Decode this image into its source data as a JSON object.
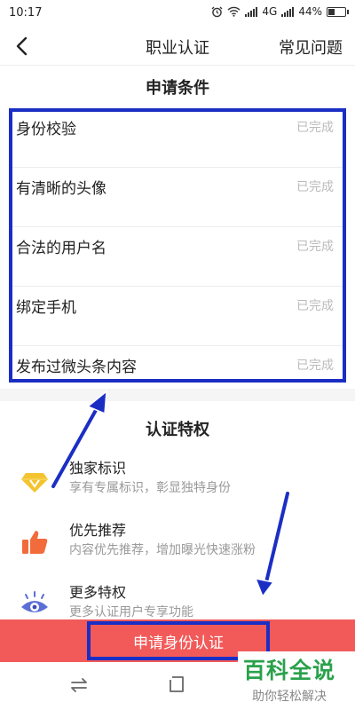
{
  "status_bar": {
    "time": "10:17",
    "network": "4G",
    "battery": "44%",
    "battery_level": 0.44
  },
  "nav": {
    "title": "职业认证",
    "faq": "常见问题"
  },
  "conditions": {
    "title": "申请条件",
    "items": [
      {
        "label": "身份校验",
        "status": "已完成"
      },
      {
        "label": "有清晰的头像",
        "status": "已完成"
      },
      {
        "label": "合法的用户名",
        "status": "已完成"
      },
      {
        "label": "绑定手机",
        "status": "已完成"
      },
      {
        "label": "发布过微头条内容",
        "status": "已完成"
      }
    ]
  },
  "privileges": {
    "title": "认证特权",
    "items": [
      {
        "title": "独家标识",
        "desc": "享有专属标识，彰显独特身份",
        "icon": "diamond-icon",
        "color": "#f4c430"
      },
      {
        "title": "优先推荐",
        "desc": "内容优先推荐，增加曝光快速涨粉",
        "icon": "thumbs-up-icon",
        "color": "#f26b3a"
      },
      {
        "title": "更多特权",
        "desc": "更多认证用户专享功能",
        "icon": "eye-icon",
        "color": "#5b6fd6"
      }
    ]
  },
  "apply_button": {
    "label": "申请身份认证"
  },
  "watermark": {
    "main": "百科全说",
    "sub": "助你轻松解决"
  },
  "colors": {
    "accent": "#f25a5a",
    "annotation": "#1b2ec4",
    "watermark": "#2aa14b"
  }
}
